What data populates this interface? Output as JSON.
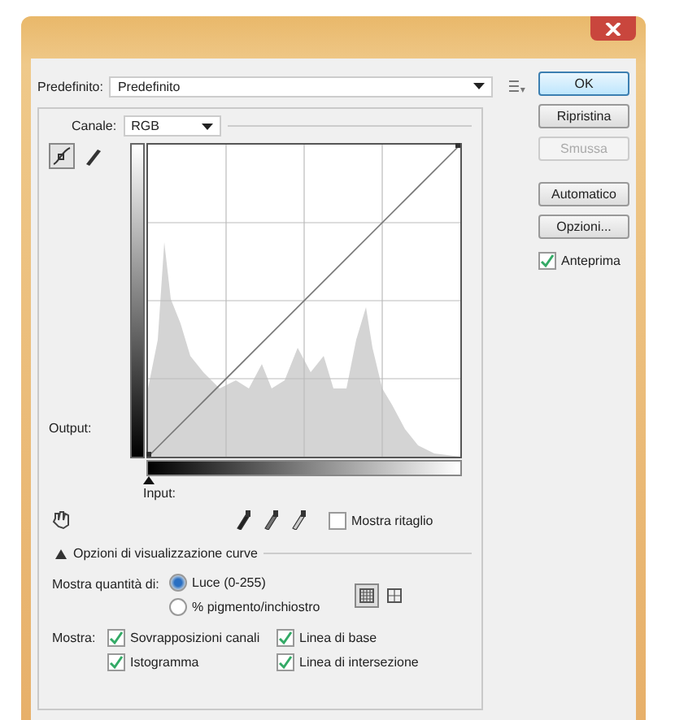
{
  "preset": {
    "label": "Predefinito:",
    "value": "Predefinito"
  },
  "channel": {
    "label": "Canale:",
    "value": "RGB"
  },
  "curve_tools": [
    {
      "kind": "points",
      "selected": true
    },
    {
      "kind": "pencil",
      "selected": false
    }
  ],
  "graph": {
    "output_label": "Output:",
    "input_label": "Input:"
  },
  "show_clipping": {
    "label": "Mostra ritaglio",
    "checked": false
  },
  "buttons": [
    {
      "label": "OK",
      "default": true,
      "disabled": false
    },
    {
      "label": "Ripristina",
      "default": false,
      "disabled": false
    },
    {
      "label": "Smussa",
      "default": false,
      "disabled": true
    },
    {
      "label": "Automatico",
      "default": false,
      "disabled": false
    },
    {
      "label": "Opzioni...",
      "default": false,
      "disabled": false
    }
  ],
  "preview": {
    "label": "Anteprima",
    "checked": true
  },
  "display_options": {
    "title": "Opzioni di visualizzazione curve",
    "expanded": true,
    "amount_label": "Mostra quantità di:",
    "amount_options": [
      {
        "label": "Luce (0-255)",
        "selected": true
      },
      {
        "label": "% pigmento/inchiostro",
        "selected": false
      }
    ],
    "grid_sizes": [
      {
        "kind": "fine",
        "selected": true
      },
      {
        "kind": "coarse",
        "selected": false
      }
    ],
    "show_label": "Mostra:",
    "show_options": [
      {
        "label": "Sovrapposizioni canali",
        "checked": true
      },
      {
        "label": "Linea di base",
        "checked": true
      },
      {
        "label": "Istogramma",
        "checked": true
      },
      {
        "label": "Linea di intersezione",
        "checked": true
      }
    ]
  }
}
